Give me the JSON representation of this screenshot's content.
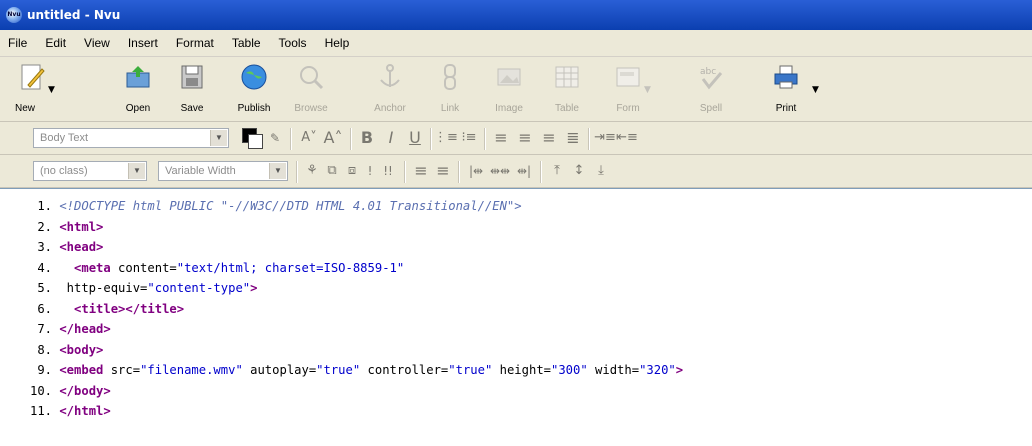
{
  "window": {
    "title": "untitled - Nvu",
    "app_icon_text": "Nvu"
  },
  "menu": [
    {
      "label": "File"
    },
    {
      "label": "Edit"
    },
    {
      "label": "View"
    },
    {
      "label": "Insert"
    },
    {
      "label": "Format"
    },
    {
      "label": "Table"
    },
    {
      "label": "Tools"
    },
    {
      "label": "Help"
    }
  ],
  "toolbar": {
    "new": "New",
    "open": "Open",
    "save": "Save",
    "publish": "Publish",
    "browse": "Browse",
    "anchor": "Anchor",
    "link": "Link",
    "image": "Image",
    "table": "Table",
    "form": "Form",
    "spell": "Spell",
    "print": "Print"
  },
  "format_bar": {
    "paragraph_format": "Body Text",
    "class": "(no class)",
    "font": "Variable Width"
  },
  "code_lines": [
    {
      "num": "1.",
      "text": "<!DOCTYPE html PUBLIC \"-//W3C//DTD HTML 4.01 Transitional//EN\">"
    },
    {
      "num": "2.",
      "text": "<html>"
    },
    {
      "num": "3.",
      "text": "<head>"
    },
    {
      "num": "4.",
      "text": "  <meta content=\"text/html; charset=ISO-8859-1\""
    },
    {
      "num": "5.",
      "text": " http-equiv=\"content-type\">"
    },
    {
      "num": "6.",
      "text": "  <title></title>"
    },
    {
      "num": "7.",
      "text": "</head>"
    },
    {
      "num": "8.",
      "text": "<body>"
    },
    {
      "num": "9.",
      "text": "<embed src=\"filename.wmv\" autoplay=\"true\" controller=\"true\" height=\"300\" width=\"320\">"
    },
    {
      "num": "10.",
      "text": "</body>"
    },
    {
      "num": "11.",
      "text": "</html>"
    }
  ],
  "colors": {
    "titlebar": "#0b3fb0",
    "tag": "#800080",
    "value": "#0000cc",
    "doctype": "#5a6fb0"
  }
}
